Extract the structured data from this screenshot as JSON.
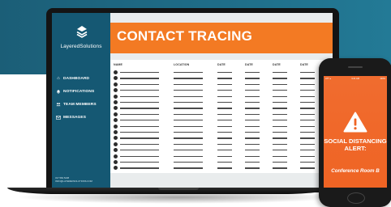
{
  "brand": {
    "name": "LayeredSolutions"
  },
  "sidebar": {
    "items": [
      {
        "label": "DASHBOARD",
        "icon": "home-icon"
      },
      {
        "label": "NOTIFICATIONS",
        "icon": "bell-icon"
      },
      {
        "label": "TEAM MEMBERS",
        "icon": "users-icon"
      },
      {
        "label": "MESSAGES",
        "icon": "envelope-icon"
      }
    ],
    "contact_line1": "317.584.5238",
    "contact_line2": "INFO@LAYEREDSOLUTIONS.COM"
  },
  "page": {
    "title": "CONTACT TRACING"
  },
  "table": {
    "headers": [
      "NAME",
      "LOCATION",
      "DATE",
      "DATE",
      "DATE",
      "DATE"
    ]
  },
  "phone": {
    "status_left": "ATT  ●",
    "status_time": "9:41 AM",
    "status_right": "100%",
    "alert_title": "SOCIAL DISTANCING ALERT:",
    "alert_location": "Conference Room B",
    "alert_icon": "warning-triangle-icon"
  },
  "colors": {
    "brand_teal": "#155873",
    "accent_orange": "#f37a23",
    "alert_orange": "#ef6424"
  }
}
